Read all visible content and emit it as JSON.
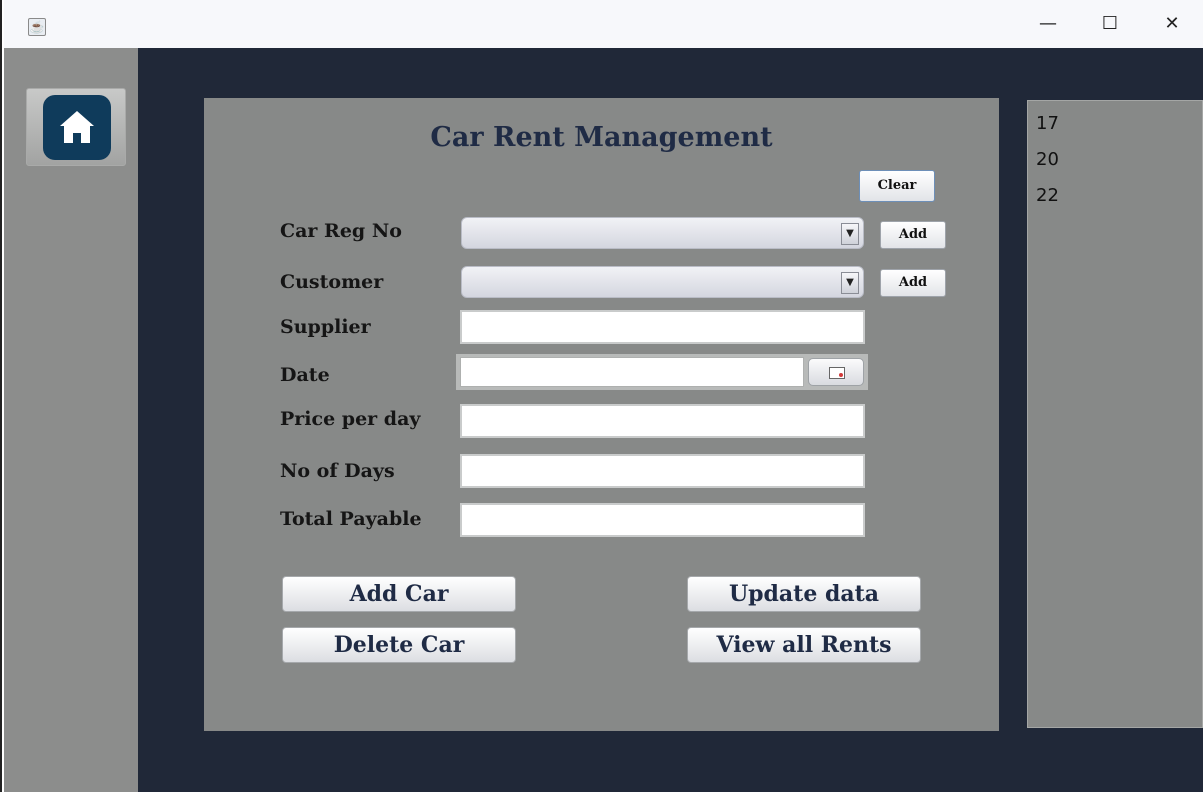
{
  "window": {
    "title": "",
    "controls": {
      "minimize": "—",
      "maximize": "☐",
      "close": "✕"
    }
  },
  "sidebar": {
    "home_icon": "home-icon"
  },
  "form": {
    "title": "Car Rent Management",
    "clear_label": "Clear",
    "car_reg_label": "Car Reg No",
    "car_reg_add_label": "Add",
    "customer_label": "Customer",
    "customer_add_label": "Add",
    "supplier_label": "Supplier",
    "date_label": "Date",
    "price_label": "Price per day",
    "days_label": "No of Days",
    "total_label": "Total Payable",
    "values": {
      "car_reg": "",
      "customer": "",
      "supplier": "",
      "date": "",
      "price": "",
      "days": "",
      "total": ""
    }
  },
  "actions": {
    "add_car": "Add Car",
    "update_data": "Update data",
    "delete_car": "Delete Car",
    "view_all_rents": "View all Rents"
  },
  "rent_list": {
    "items": [
      "17",
      "20",
      "22"
    ]
  },
  "colors": {
    "sidebar": "#8c8d8c",
    "background": "#202838",
    "panel": "#878988",
    "title_text": "#1f2b45",
    "home_tile": "#0f3b5b"
  }
}
